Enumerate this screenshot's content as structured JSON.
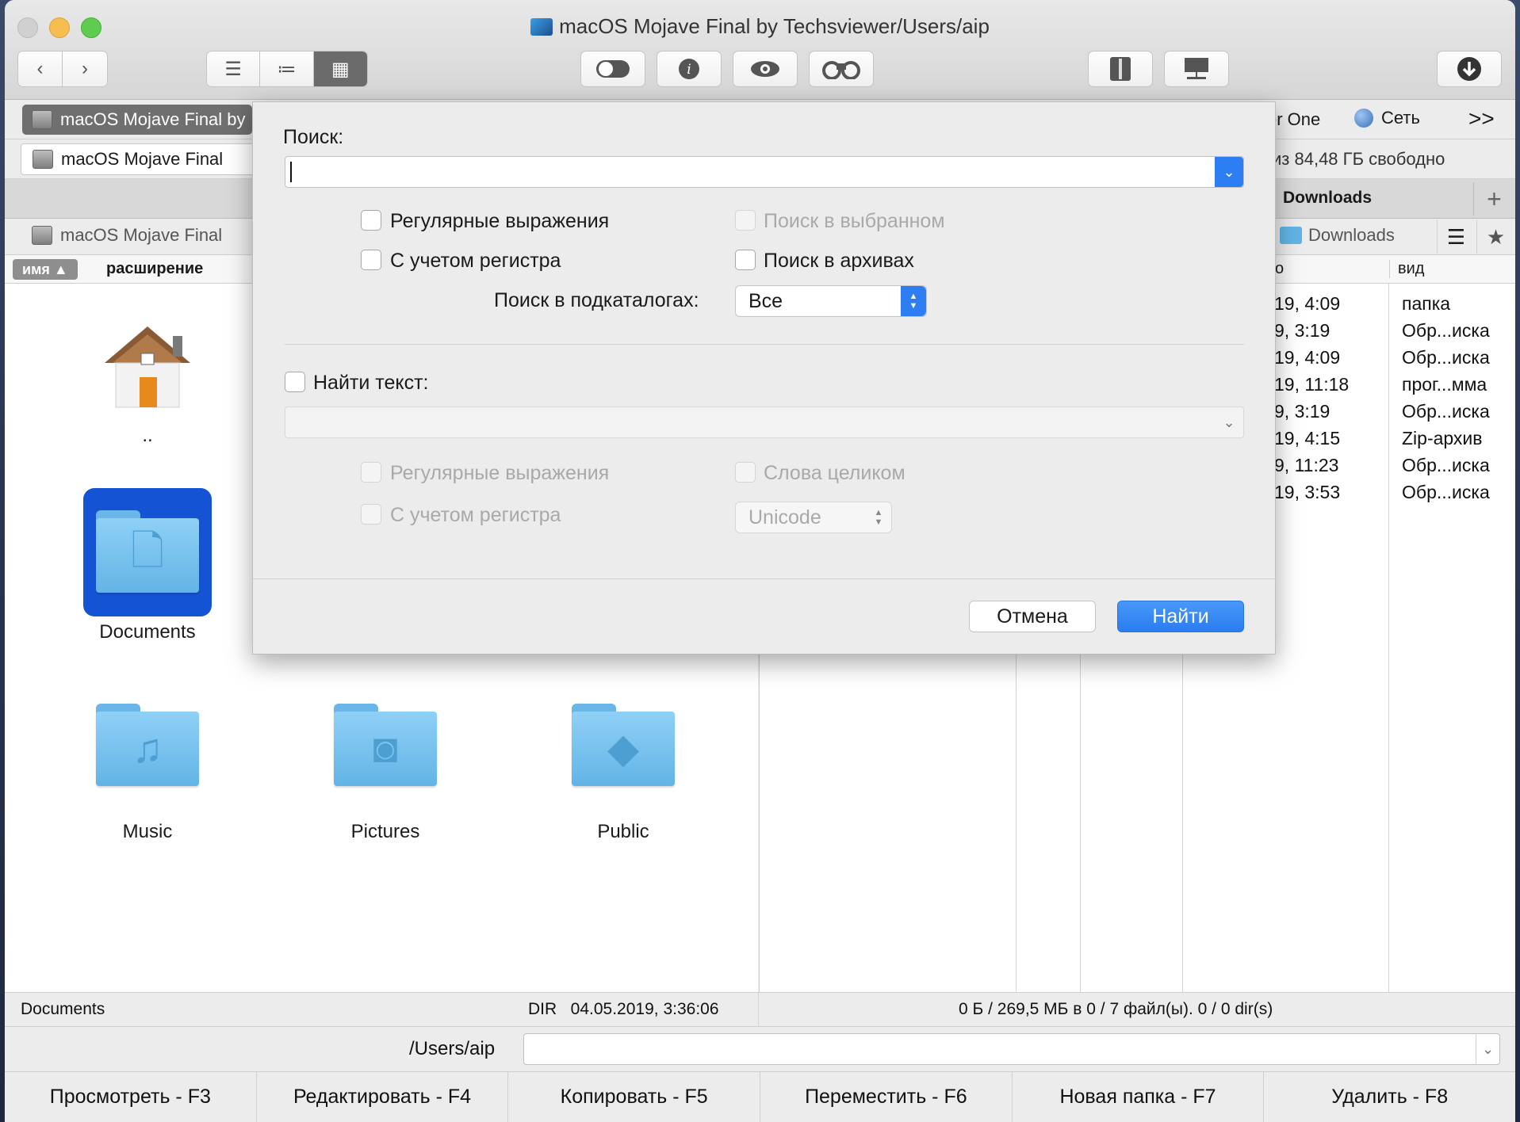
{
  "window": {
    "title": "macOS Mojave Final by Techsviewer/Users/aip"
  },
  "drivebar": {
    "left_drive": "macOS Mojave Final by",
    "right_partial": "er One",
    "network": "Сеть",
    "more": ">>"
  },
  "infobar": {
    "left_drive": "macOS Mojave Final",
    "right_free": "из 84,48 ГБ свободно"
  },
  "tabs": {
    "right_tab": "Downloads",
    "add": "+"
  },
  "paths": {
    "left": "macOS Mojave Final",
    "right": "Downloads"
  },
  "columns": {
    "left": [
      "имя ▲",
      "расширение"
    ],
    "right_partial": "о",
    "right_kind": "вид"
  },
  "left_pane": {
    "items": [
      {
        "name": ".."
      },
      {
        "name": "Documents"
      },
      {
        "name": "Music"
      },
      {
        "name": "Pictures"
      },
      {
        "name": "Public"
      }
    ]
  },
  "right_pane": {
    "rows": [
      {
        "date": "19, 4:09",
        "kind": "папка"
      },
      {
        "date": "9, 3:19",
        "kind": "Обр...иска"
      },
      {
        "date": "19, 4:09",
        "kind": "Обр...иска"
      },
      {
        "date": "19, 11:18",
        "kind": "прог...мма"
      },
      {
        "date": "9, 3:19",
        "kind": "Обр...иска"
      },
      {
        "date": "19, 4:15",
        "kind": "Zip-архив"
      },
      {
        "date": "9, 11:23",
        "kind": "Обр...иска"
      },
      {
        "date": "19, 3:53",
        "kind": "Обр...иска"
      }
    ]
  },
  "status": {
    "left_name": "Documents",
    "left_info": "DIR   04.05.2019, 3:36:06",
    "right_info": "0 Б / 269,5 МБ в 0 / 7 файл(ы). 0 / 0 dir(s)"
  },
  "command": {
    "path": "/Users/aip",
    "value": ""
  },
  "fkeys": [
    "Просмотреть - F3",
    "Редактировать - F4",
    "Копировать - F5",
    "Переместить - F6",
    "Новая папка - F7",
    "Удалить - F8"
  ],
  "dialog": {
    "search_label": "Поиск:",
    "search_value": "",
    "regex": "Регулярные выражения",
    "case": "С учетом регистра",
    "in_selected": "Поиск в выбранном",
    "in_archives": "Поиск в архивах",
    "subdirs_label": "Поиск в подкаталогах:",
    "subdirs_value": "Все",
    "find_text_label": "Найти текст:",
    "text_regex": "Регулярные выражения",
    "text_case": "С учетом регистра",
    "whole_words": "Слова целиком",
    "encoding": "Unicode",
    "cancel": "Отмена",
    "find": "Найти"
  }
}
